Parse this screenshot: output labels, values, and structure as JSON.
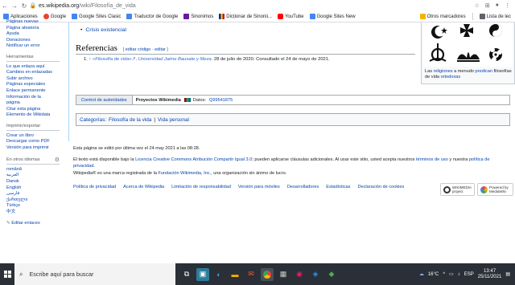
{
  "browser": {
    "url_host": "es.wikipedia.org",
    "url_path": "/wiki/Filosofía_de_vida",
    "bookmarks": [
      {
        "label": "Aplicaciones",
        "color": "#4285f4"
      },
      {
        "label": "Google",
        "color": "#ea4335"
      },
      {
        "label": "Google Sites Clasic",
        "color": "#4285f4"
      },
      {
        "label": "Traductor de Google",
        "color": "#4285f4"
      },
      {
        "label": "Sinonimos",
        "color": "#6a1b9a"
      },
      {
        "label": "Dicționar de Sinonii...",
        "color": "#d32f2f"
      },
      {
        "label": "YouTube",
        "color": "#ff0000"
      },
      {
        "label": "Google Sites New",
        "color": "#4285f4"
      }
    ],
    "other_bookmarks": "Otros marcadores",
    "reading_list": "Lista de lec"
  },
  "sidebar": {
    "top_links": [
      "Páginas nuevas",
      "Página aleatoria",
      "Ayuda",
      "Donaciones",
      "Notificar un error"
    ],
    "tools_header": "Herramientas",
    "tools_links": [
      "Lo que enlaza aquí",
      "Cambios en enlazadas",
      "Subir archivo",
      "Páginas especiales",
      "Enlace permanente",
      "Información de la página",
      "Citar esta página",
      "Elemento de Wikidata"
    ],
    "print_header": "Imprimir/exportar",
    "print_links": [
      "Crear un libro",
      "Descargar como PDF",
      "Versión para imprimir"
    ],
    "lang_header": "En otros idiomas",
    "languages": [
      "română",
      "العربية",
      "Dansk",
      "English",
      "فارسی",
      "ქართული",
      "Türkçe",
      "中文"
    ],
    "edit_links": "Editar enlaces"
  },
  "article": {
    "bullet_item": "Crisis existencial",
    "refs_heading": "Referencias",
    "edit_code": "editar código",
    "edit": "editar",
    "ref_num": "1.",
    "ref_caret": "↑",
    "ref_title": "«Filosofía de vida»",
    "ref_publisher": "Universidad Jaime Bausate y Meza",
    "ref_rest": ". 28 de julio de 2020. Consultado el 24 de mayo de 2021.",
    "infobox_caption_1": "Las ",
    "infobox_caption_link1": "religiones",
    "infobox_caption_2": " a menudo ",
    "infobox_caption_link2": "predican",
    "infobox_caption_3": " filosofías de vida ",
    "infobox_caption_link3": "ortodoxas",
    "authority_label": "Control de autoridades",
    "wikimedia_projects": "Proyectos Wikimedia",
    "data_label": "Datos:",
    "data_id": "Q99541875",
    "categories_label": "Categorías",
    "categories": [
      "Filosofía de la vida",
      "Vida personal"
    ]
  },
  "footer": {
    "last_edit": "Esta página se editó por última vez el 24 may 2021 a las 08:28.",
    "license_1": "El texto está disponible bajo la ",
    "license_link": "Licencia Creative Commons Atribución Compartir Igual 3.0",
    "license_2": "; pueden aplicarse cláusulas adicionales. Al usar este sitio, usted acepta nuestros ",
    "terms_link": "términos de uso",
    "license_3": " y nuestra ",
    "privacy_link": "política de privacidad",
    "license_4": ".",
    "trademark_1": "Wikipedia® es una marca registrada de la ",
    "foundation_link": "Fundación Wikimedia, Inc.",
    "trademark_2": ", una organización sin ánimo de lucro.",
    "links": [
      "Política de privacidad",
      "Acerca de Wikipedia",
      "Limitación de responsabilidad",
      "Versión para móviles",
      "Desarrolladores",
      "Estadísticas",
      "Declaración de cookies"
    ],
    "badge_wikimedia": "WIKIMEDIA project",
    "badge_mediawiki": "Powered by MediaWiki"
  },
  "taskbar": {
    "search_placeholder": "Escribe aquí para buscar",
    "temperature": "16°C",
    "lang": "ESP",
    "time": "13:47",
    "date": "25/11/2021"
  }
}
